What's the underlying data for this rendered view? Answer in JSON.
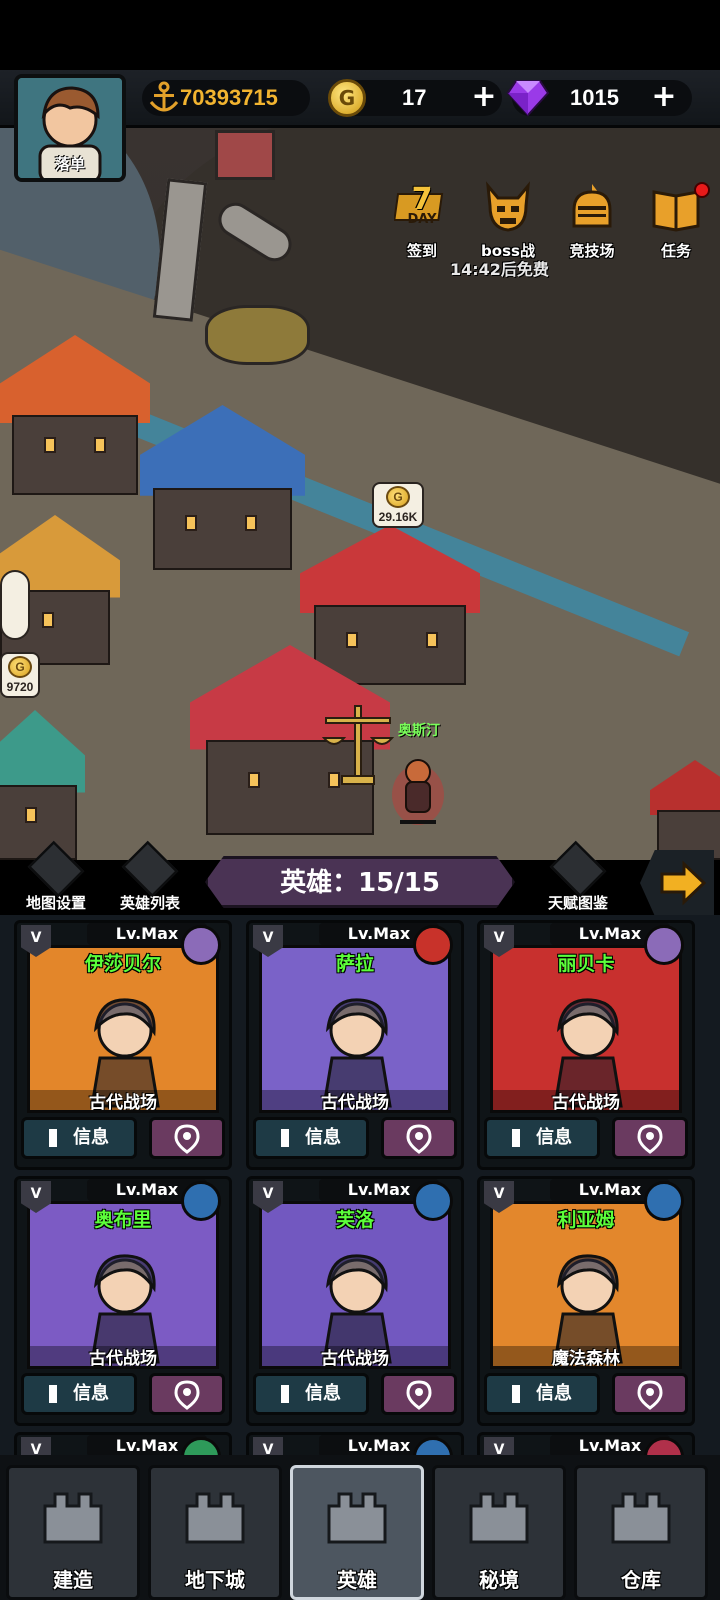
{
  "player": {
    "name": "落单"
  },
  "resources": {
    "trophy": "70393715",
    "gold": "17",
    "gems": "1015"
  },
  "events": [
    {
      "label": "签到",
      "badge": "7",
      "badge_sub": "DAY"
    },
    {
      "label": "boss战"
    },
    {
      "label": "竞技场"
    },
    {
      "label": "任务"
    }
  ],
  "boss_timer": "14:42后免费",
  "map": {
    "coin_bubble_1": "29.16K",
    "coin_bubble_2": "9720",
    "hero_name": "奥斯汀",
    "coin_letter": "G"
  },
  "panel": {
    "map_settings": "地图设置",
    "hero_list": "英雄列表",
    "hero_count": "英雄：15/15",
    "talent_book": "天赋图鉴"
  },
  "cards": [
    {
      "name": "伊莎贝尔",
      "level": "Lv.Max",
      "rank": "V",
      "location": "古代战场",
      "info": "信息",
      "bg": "#e3862a",
      "elem": "#8b6bb8"
    },
    {
      "name": "萨拉",
      "level": "Lv.Max",
      "rank": "V",
      "location": "古代战场",
      "info": "信息",
      "bg": "#7a62c8",
      "elem": "#c8322a"
    },
    {
      "name": "丽贝卡",
      "level": "Lv.Max",
      "rank": "V",
      "location": "古代战场",
      "info": "信息",
      "bg": "#c8302e",
      "elem": "#8b6bb8"
    },
    {
      "name": "奥布里",
      "level": "Lv.Max",
      "rank": "V",
      "location": "古代战场",
      "info": "信息",
      "bg": "#7c5bc4",
      "elem": "#2f6fb0"
    },
    {
      "name": "芙洛",
      "level": "Lv.Max",
      "rank": "V",
      "location": "古代战场",
      "info": "信息",
      "bg": "#7258c0",
      "elem": "#2f6fb0"
    },
    {
      "name": "利亚姆",
      "level": "Lv.Max",
      "rank": "V",
      "location": "魔法森林",
      "info": "信息",
      "bg": "#e3872c",
      "elem": "#2f6fb0"
    }
  ],
  "partial_row": [
    {
      "level": "Lv.Max",
      "rank": "V",
      "elem": "#2e9a5a"
    },
    {
      "level": "Lv.Max",
      "rank": "V",
      "elem": "#2f6fb0"
    },
    {
      "level": "Lv.Max",
      "rank": "V",
      "elem": "#b0304a"
    }
  ],
  "nav": [
    {
      "label": "建造",
      "icon": "castle-icon"
    },
    {
      "label": "地下城",
      "icon": "crown-shield-icon"
    },
    {
      "label": "英雄",
      "icon": "helmet-icon",
      "active": true
    },
    {
      "label": "秘境",
      "icon": "haunted-house-icon"
    },
    {
      "label": "仓库",
      "icon": "sack-icon"
    }
  ]
}
